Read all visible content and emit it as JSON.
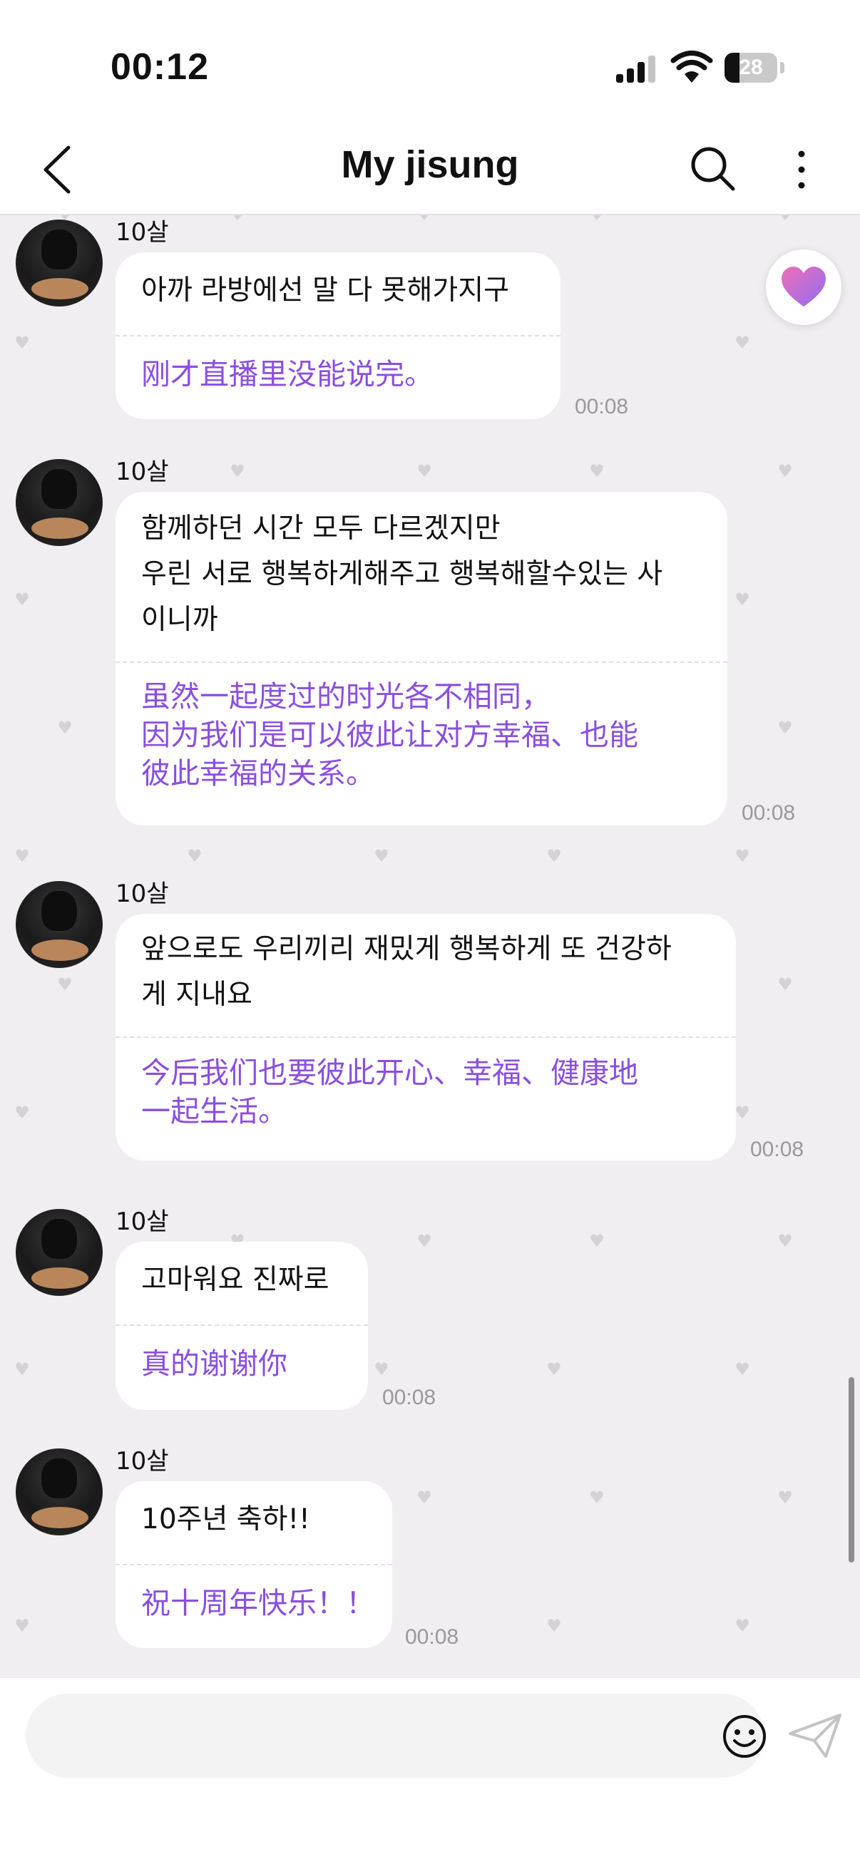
{
  "status_bar": {
    "time": "00:12",
    "battery": "28",
    "battery_level": 0.28
  },
  "header": {
    "title": "My jisung",
    "back_icon": "chevron-left-icon",
    "search_icon": "search-icon",
    "more_icon": "more-vertical-icon"
  },
  "messages": [
    {
      "sender": "10살",
      "original_lines": [
        "아까 라방에선 말 다 못해가지구"
      ],
      "translated_lines": [
        "刚才直播里没能说完。"
      ],
      "time": "00:08"
    },
    {
      "sender": "10살",
      "original_lines": [
        "함께하던 시간 모두 다르겠지만",
        "우린 서로 행복하게해주고 행복해할수있는 사",
        "이니까"
      ],
      "translated_lines": [
        "虽然一起度过的时光各不相同，",
        "因为我们是可以彼此让对方幸福、也能",
        "彼此幸福的关系。"
      ],
      "time": "00:08"
    },
    {
      "sender": "10살",
      "original_lines": [
        "앞으로도 우리끼리 재밌게 행복하게 또 건강하",
        "게 지내요"
      ],
      "translated_lines": [
        "今后我们也要彼此开心、幸福、健康地",
        "一起生活。"
      ],
      "time": "00:08"
    },
    {
      "sender": "10살",
      "original_lines": [
        "고마워요 진짜로"
      ],
      "translated_lines": [
        "真的谢谢你"
      ],
      "time": "00:08"
    },
    {
      "sender": "10살",
      "original_lines": [
        "10주년 축하!!"
      ],
      "translated_lines": [
        "祝十周年快乐！！"
      ],
      "time": "00:08"
    }
  ],
  "floating_button": {
    "icon": "heart-icon"
  },
  "input_bar": {
    "placeholder": "",
    "emoji_icon": "emoji-icon",
    "send_icon": "send-icon"
  },
  "colors": {
    "background": "#f0eef0",
    "bubble": "#ffffff",
    "translation_text": "#8a4fdf",
    "timestamp": "#9a999a",
    "heart_gradient_start": "#f06fb6",
    "heart_gradient_end": "#8f6df4"
  }
}
